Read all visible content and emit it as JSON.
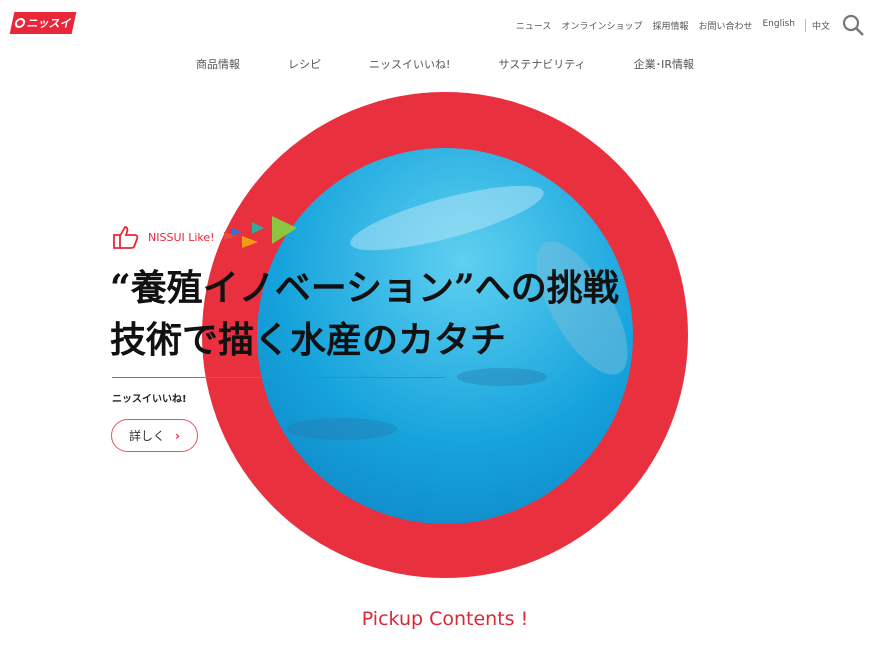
{
  "header": {
    "logo": "ニッスイ",
    "utility": [
      "ニュース",
      "オンラインショップ",
      "採用情報",
      "お問い合わせ",
      "English",
      "中文"
    ]
  },
  "nav": [
    "商品情報",
    "レシピ",
    "ニッスイいいね!",
    "サステナビリティ",
    "企業･IR情報"
  ],
  "hero": {
    "badge": "NISSUI Like!",
    "title_line1": "“養殖イノベーション”への挑戦",
    "title_line2": "技術で描く水産のカタチ",
    "category": "ニッスイいいね!",
    "more_label": "詳しく"
  },
  "pickup": "Pickup Contents !",
  "colors": {
    "brand": "#e8283a"
  }
}
